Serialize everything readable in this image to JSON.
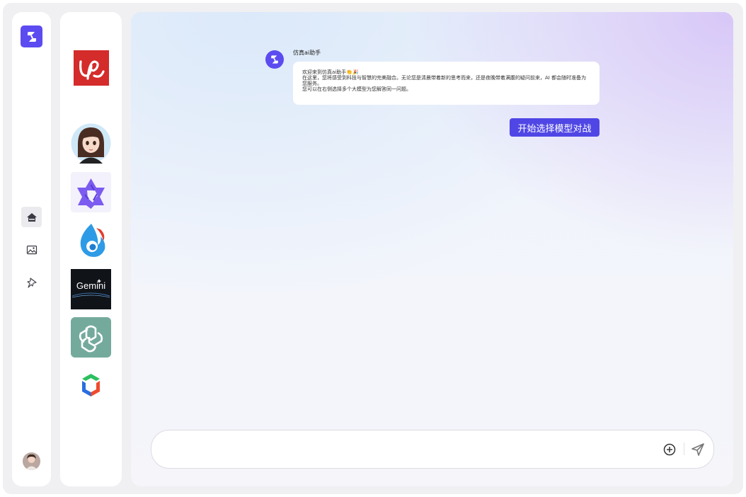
{
  "app": {
    "logo_icon": "app-logo-icon",
    "brand_color": "#5b4bf0"
  },
  "rail": {
    "items": [
      {
        "icon": "home-icon",
        "active": true
      },
      {
        "icon": "image-icon",
        "active": false
      },
      {
        "icon": "pin-icon",
        "active": false
      }
    ],
    "user_avatar": "user-avatar"
  },
  "models": [
    {
      "name": "ue-logo",
      "bg": "#d42b2b"
    },
    {
      "name": "girl-avatar",
      "bg": "#cfe8f7"
    },
    {
      "name": "qwen-logo",
      "bg": "#f3f1fb"
    },
    {
      "name": "flame-logo",
      "bg": "#ffffff"
    },
    {
      "name": "gemini-logo",
      "bg": "#101318",
      "label": "Gemini"
    },
    {
      "name": "chatgpt-logo",
      "bg": "#74aa9c"
    },
    {
      "name": "cube-logo",
      "bg": "#ffffff"
    }
  ],
  "chat": {
    "bot_name": "仿真ai助手",
    "message_lines": [
      "欢迎来到仿真ai助手👏🎉",
      "在这里，您将感受到科技与智慧的完美融合。无论您是清晨带着新的思考而来，还是夜晚带着满腹的疑问前来，AI 都会随时准备为您服务。",
      "您可以在右侧选择多个大模型为您解答同一问题。"
    ],
    "start_button": "开始选择模型对战"
  },
  "composer": {
    "placeholder": "",
    "value": ""
  },
  "colors": {
    "accent": "#4f46e5",
    "chatgpt": "#74aa9c"
  }
}
